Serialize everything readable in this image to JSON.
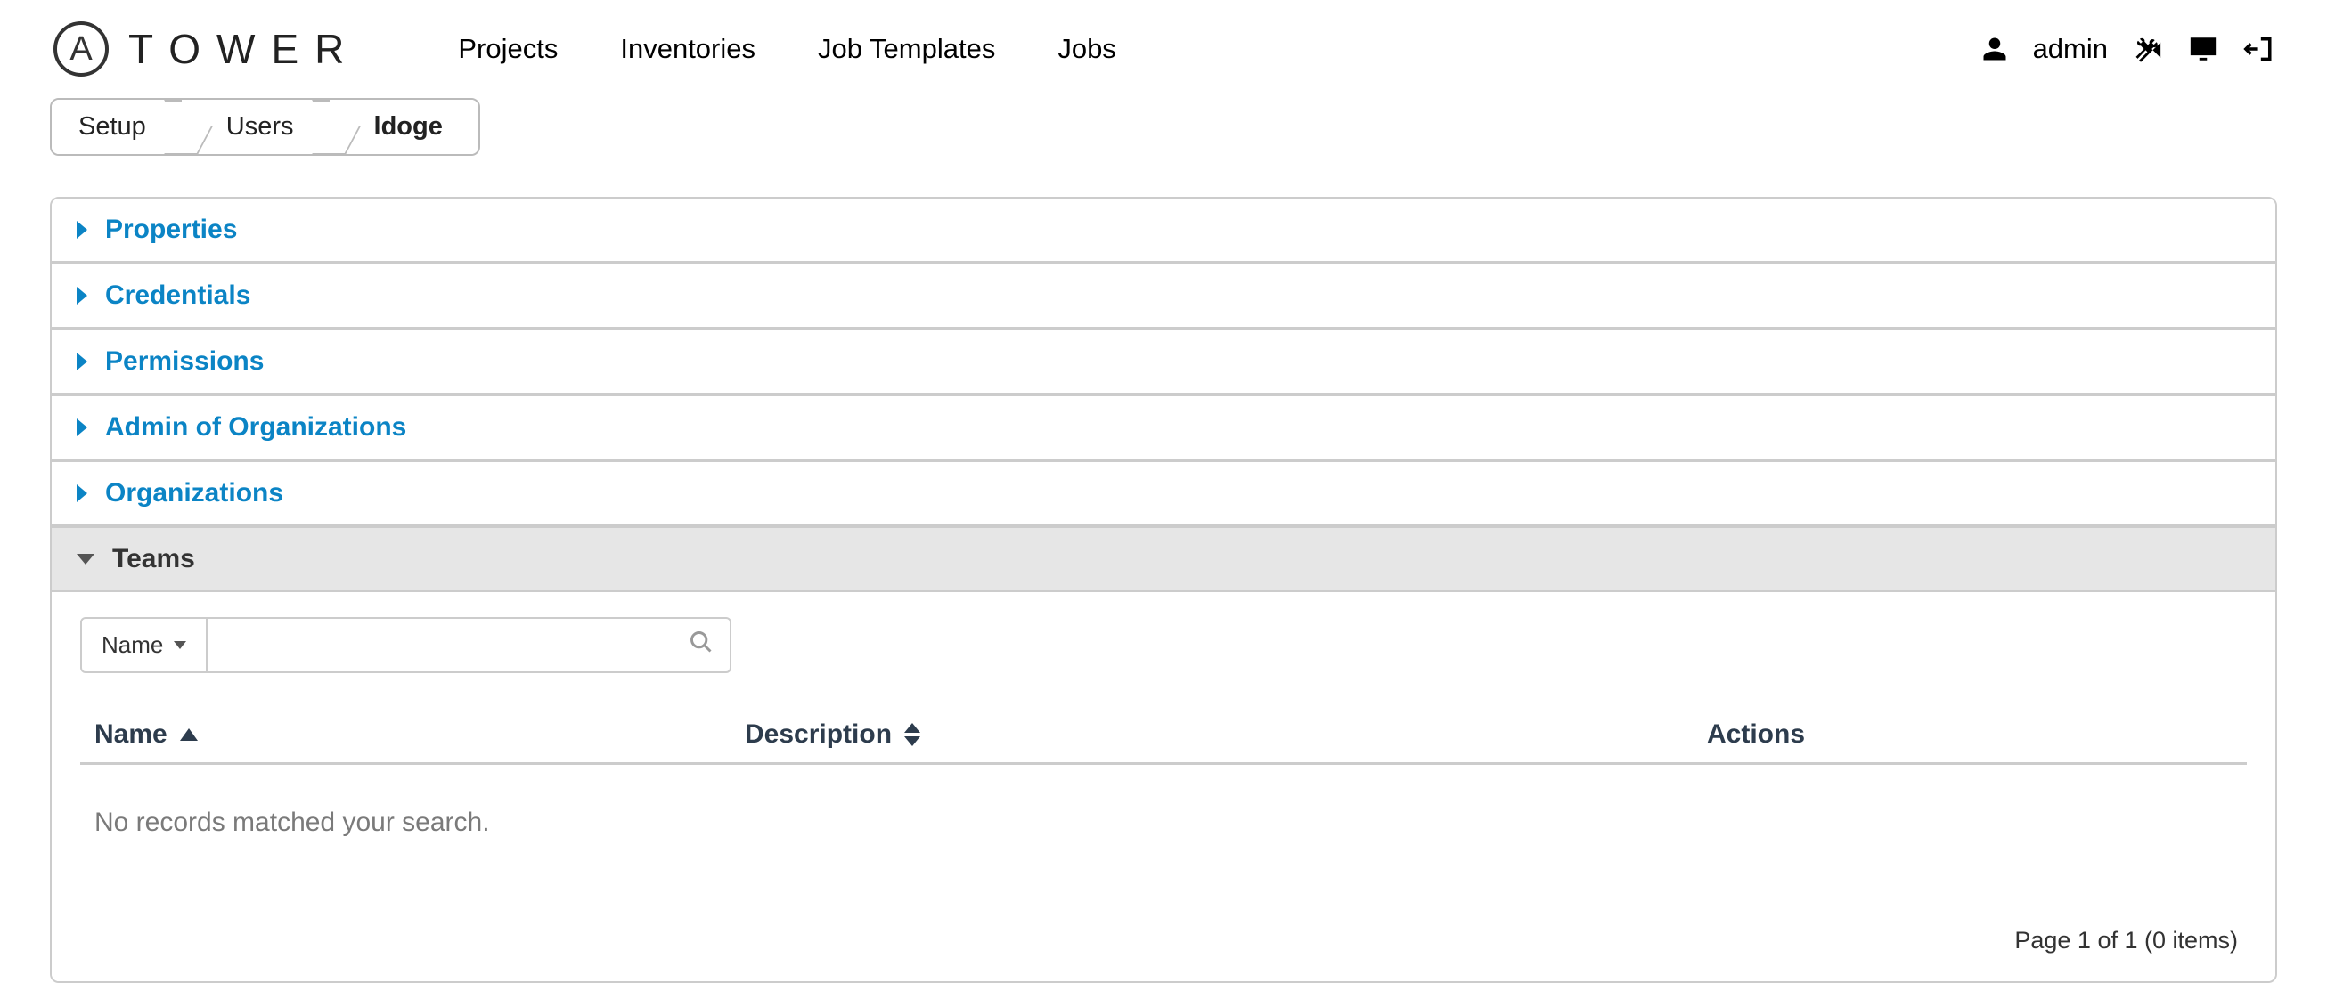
{
  "brand": {
    "logo_letter": "A",
    "name": "TOWER"
  },
  "nav": {
    "projects": "Projects",
    "inventories": "Inventories",
    "job_templates": "Job Templates",
    "jobs": "Jobs"
  },
  "account": {
    "username": "admin"
  },
  "breadcrumbs": {
    "setup": "Setup",
    "users": "Users",
    "current": "ldoge"
  },
  "accordions": {
    "properties": "Properties",
    "credentials": "Credentials",
    "permissions": "Permissions",
    "admin_orgs": "Admin of Organizations",
    "organizations": "Organizations",
    "teams": "Teams"
  },
  "teams_panel": {
    "filter_field": "Name",
    "search_placeholder": "",
    "columns": {
      "name": "Name",
      "description": "Description",
      "actions": "Actions"
    },
    "empty_message": "No records matched your search.",
    "pager_text": "Page 1 of 1 (0 items)"
  }
}
